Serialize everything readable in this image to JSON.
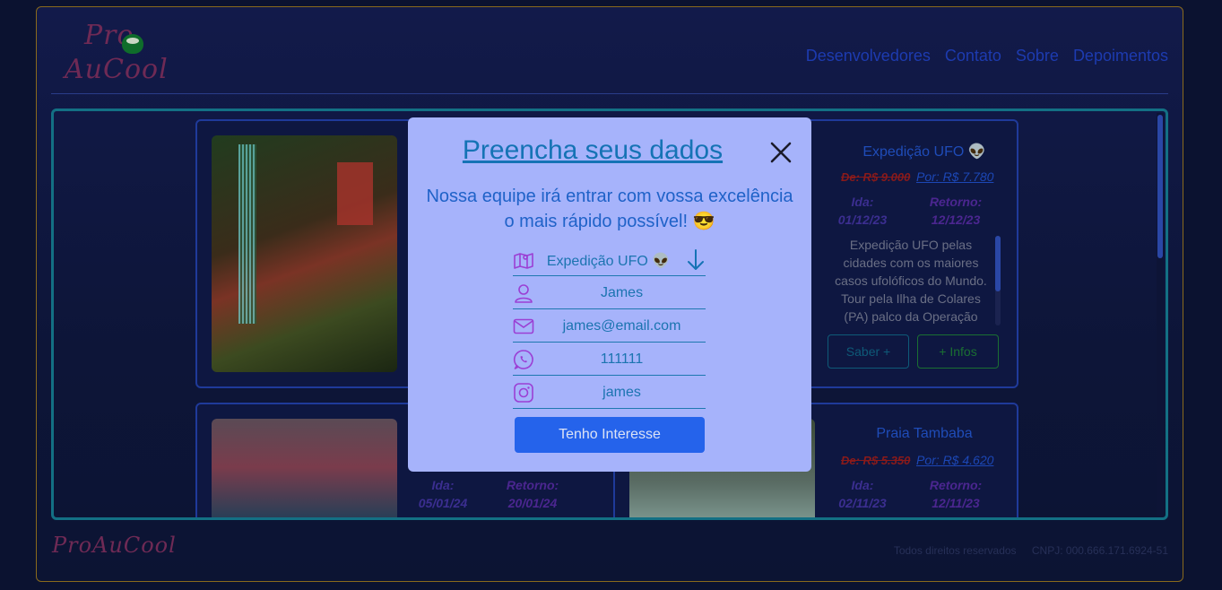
{
  "header": {
    "logo": {
      "line1": "Pro",
      "line2": "AuCool"
    },
    "nav": [
      "Desenvolvedores",
      "Contato",
      "Sobre",
      "Depoimentos"
    ]
  },
  "cards": {
    "ufo": {
      "title": "Expedição UFO 👽",
      "old_price": "De: R$ 9.000",
      "new_price": "Por: R$ 7.780",
      "ida_label": "Ida:",
      "ida_date": "01/12/23",
      "retorno_label": "Retorno:",
      "retorno_date": "12/12/23",
      "description": "Expedição UFO pelas cidades com os maiores casos ufolóficos do Mundo. Tour pela Ilha de Colares (PA) palco da Operação",
      "saber_label": "Saber +",
      "infos_label": "+ Infos"
    },
    "tokyo": {
      "ida_label": "Ida:",
      "ida_date": "05/01/24",
      "retorno_label": "Retorno:",
      "retorno_date": "20/01/24"
    },
    "tambaba": {
      "title": "Praia Tambaba",
      "old_price": "De: R$ 5.350",
      "new_price": "Por: R$ 4.620",
      "ida_label": "Ida:",
      "ida_date": "02/11/23",
      "retorno_label": "Retorno:",
      "retorno_date": "12/11/23"
    }
  },
  "modal": {
    "title": "Preencha seus dados",
    "subtitle": "Nossa equipe irá entrar com vossa excelência o mais rápido possível! 😎",
    "fields": {
      "destination": "Expedição UFO 👽",
      "name": "James",
      "email": "james@email.com",
      "phone": "111111",
      "instagram": "james"
    },
    "submit_label": "Tenho Interesse"
  },
  "footer": {
    "logo": "ProAuCool",
    "rights": "Todos direitos reservados",
    "cnpj": "CNPJ: 000.666.171.6924-51"
  },
  "colors": {
    "modal_bg": "#a6b3fb",
    "accent_blue": "#2563eb",
    "icon_purple": "#9b3fd4",
    "content_border": "#137084"
  }
}
